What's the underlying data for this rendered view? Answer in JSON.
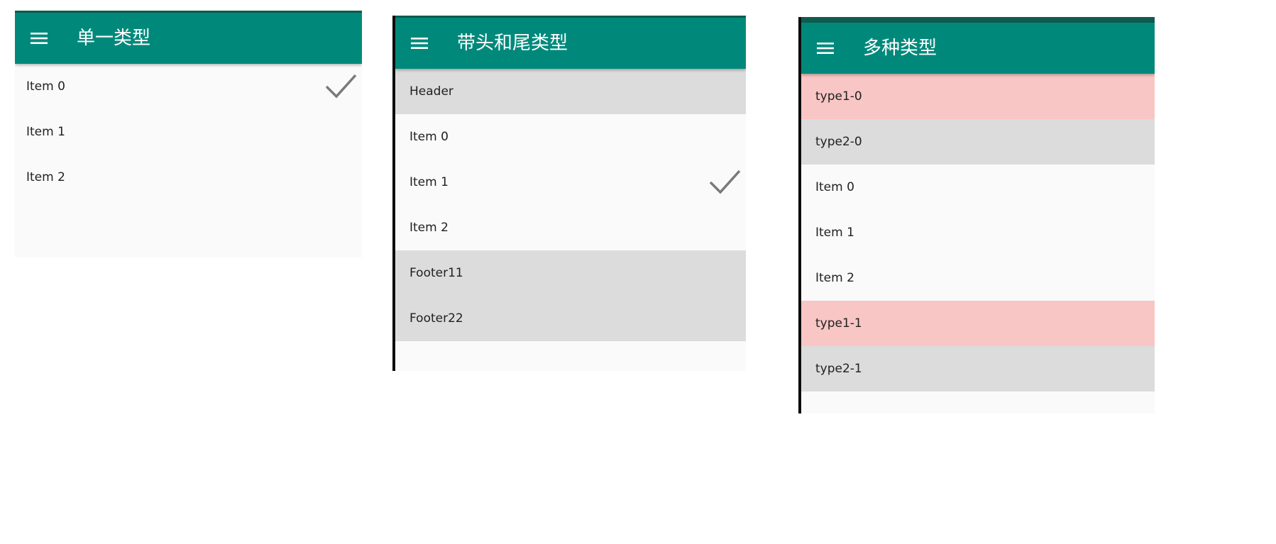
{
  "panels": {
    "single": {
      "title": "单一类型",
      "items": [
        "Item 0",
        "Item 1",
        "Item 2"
      ],
      "checked_index": 0
    },
    "header_footer": {
      "title": "带头和尾类型",
      "header": "Header",
      "items": [
        "Item 0",
        "Item 1",
        "Item 2"
      ],
      "checked_index": 1,
      "footers": [
        "Footer11",
        "Footer22"
      ]
    },
    "multi": {
      "title": "多种类型",
      "rows": [
        "type1-0",
        "type2-0",
        "Item 0",
        "Item 1",
        "Item 2",
        "type1-1",
        "type2-1"
      ]
    }
  },
  "icons": {
    "menu": "menu-icon",
    "check": "checkmark-icon"
  },
  "colors": {
    "appbar": "#00897b",
    "statusbar": "#0f5c4e",
    "row_grey": "#dcdcdc",
    "row_pink": "#f8c6c5",
    "list_bg": "#fafafa",
    "check": "#7a7a7a"
  }
}
